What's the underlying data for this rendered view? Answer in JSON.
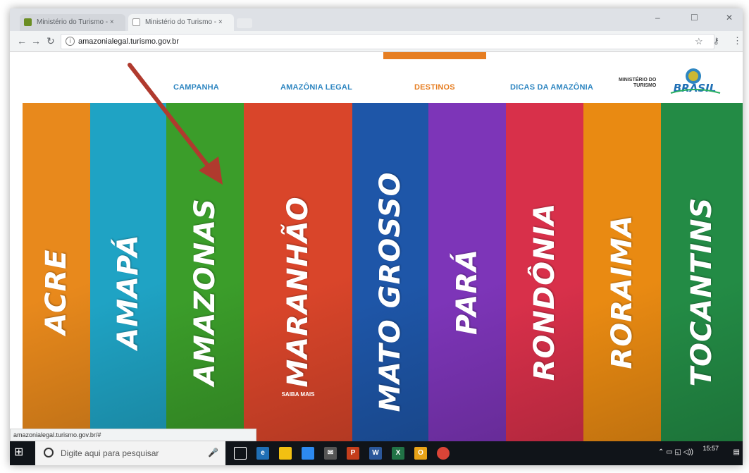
{
  "browser": {
    "tabs": [
      {
        "label": "Ministério do Turismo - ×",
        "active": false
      },
      {
        "label": "Ministério do Turismo - ×",
        "active": true
      }
    ],
    "url": "amazonialegal.turismo.gov.br",
    "nav_icons": [
      "back-icon",
      "forward-icon",
      "reload-icon",
      "info-icon"
    ],
    "right_icons": [
      "star-icon",
      "key-icon",
      "menu-icon"
    ]
  },
  "site": {
    "nav": [
      {
        "label": "CAMPANHA",
        "active": false
      },
      {
        "label": "AMAZÔNIA LEGAL",
        "active": false
      },
      {
        "label": "DESTINOS",
        "active": true
      },
      {
        "label": "DICAS DA AMAZÔNIA",
        "active": false
      }
    ],
    "ministry_line1": "MINISTÉRIO DO",
    "ministry_line2": "TURISMO",
    "logo_text": "BRASIL",
    "accent_color": "#e67e22",
    "nav_color": "#2e86c1"
  },
  "states": [
    {
      "name": "ACRE",
      "color": "#e8891c"
    },
    {
      "name": "AMAPÁ",
      "color": "#1fa3c4"
    },
    {
      "name": "AMAZONAS",
      "color": "#3b9d2a"
    },
    {
      "name": "MARANHÃO",
      "color": "#d9452a",
      "saiba_mais": "SAIBA MAIS"
    },
    {
      "name": "MATO GROSSO",
      "color": "#1e56a8"
    },
    {
      "name": "PARÁ",
      "color": "#7d35b8"
    },
    {
      "name": "RONDÔNIA",
      "color": "#d8304a"
    },
    {
      "name": "RORAIMA",
      "color": "#e98a12"
    },
    {
      "name": "TOCANTINS",
      "color": "#238b45"
    }
  ],
  "status_url": "amazonialegal.turismo.gov.br/#",
  "taskbar": {
    "search_placeholder": "Digite aqui para pesquisar",
    "time": "15:57",
    "icons": [
      "task-view-icon",
      "edge-icon",
      "file-explorer-icon",
      "store-icon",
      "mail-icon",
      "powerpoint-icon",
      "word-icon",
      "excel-icon",
      "onenote-icon",
      "chrome-icon"
    ]
  }
}
